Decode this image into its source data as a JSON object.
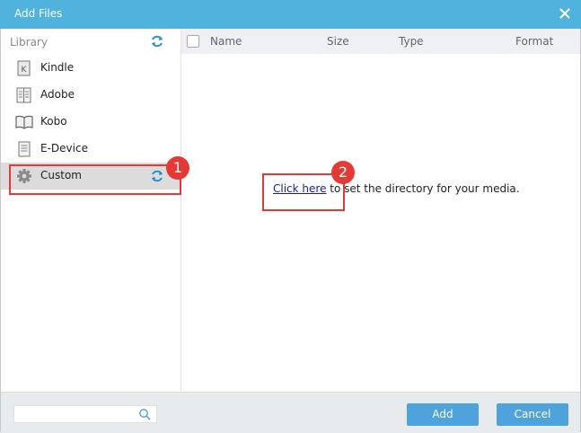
{
  "window": {
    "title": "Add Files",
    "close_icon": "close-icon"
  },
  "sidebar": {
    "heading": "Library",
    "refresh_icon": "refresh-icon",
    "items": [
      {
        "label": "Kindle",
        "icon": "kindle-icon"
      },
      {
        "label": "Adobe",
        "icon": "adobe-icon"
      },
      {
        "label": "Kobo",
        "icon": "kobo-icon"
      },
      {
        "label": "E-Device",
        "icon": "device-icon"
      },
      {
        "label": "Custom",
        "icon": "gear-icon",
        "selected": true
      }
    ]
  },
  "table": {
    "columns": [
      "Name",
      "Size",
      "Type",
      "Format"
    ]
  },
  "main": {
    "link_text": "Click here",
    "hint_text": " to set the directory for your media."
  },
  "callouts": [
    "1",
    "2"
  ],
  "footer": {
    "search_placeholder": "",
    "add_label": "Add",
    "cancel_label": "Cancel"
  },
  "colors": {
    "accent": "#4fb3de",
    "button": "#4fa3dc",
    "callout": "#e53935"
  }
}
